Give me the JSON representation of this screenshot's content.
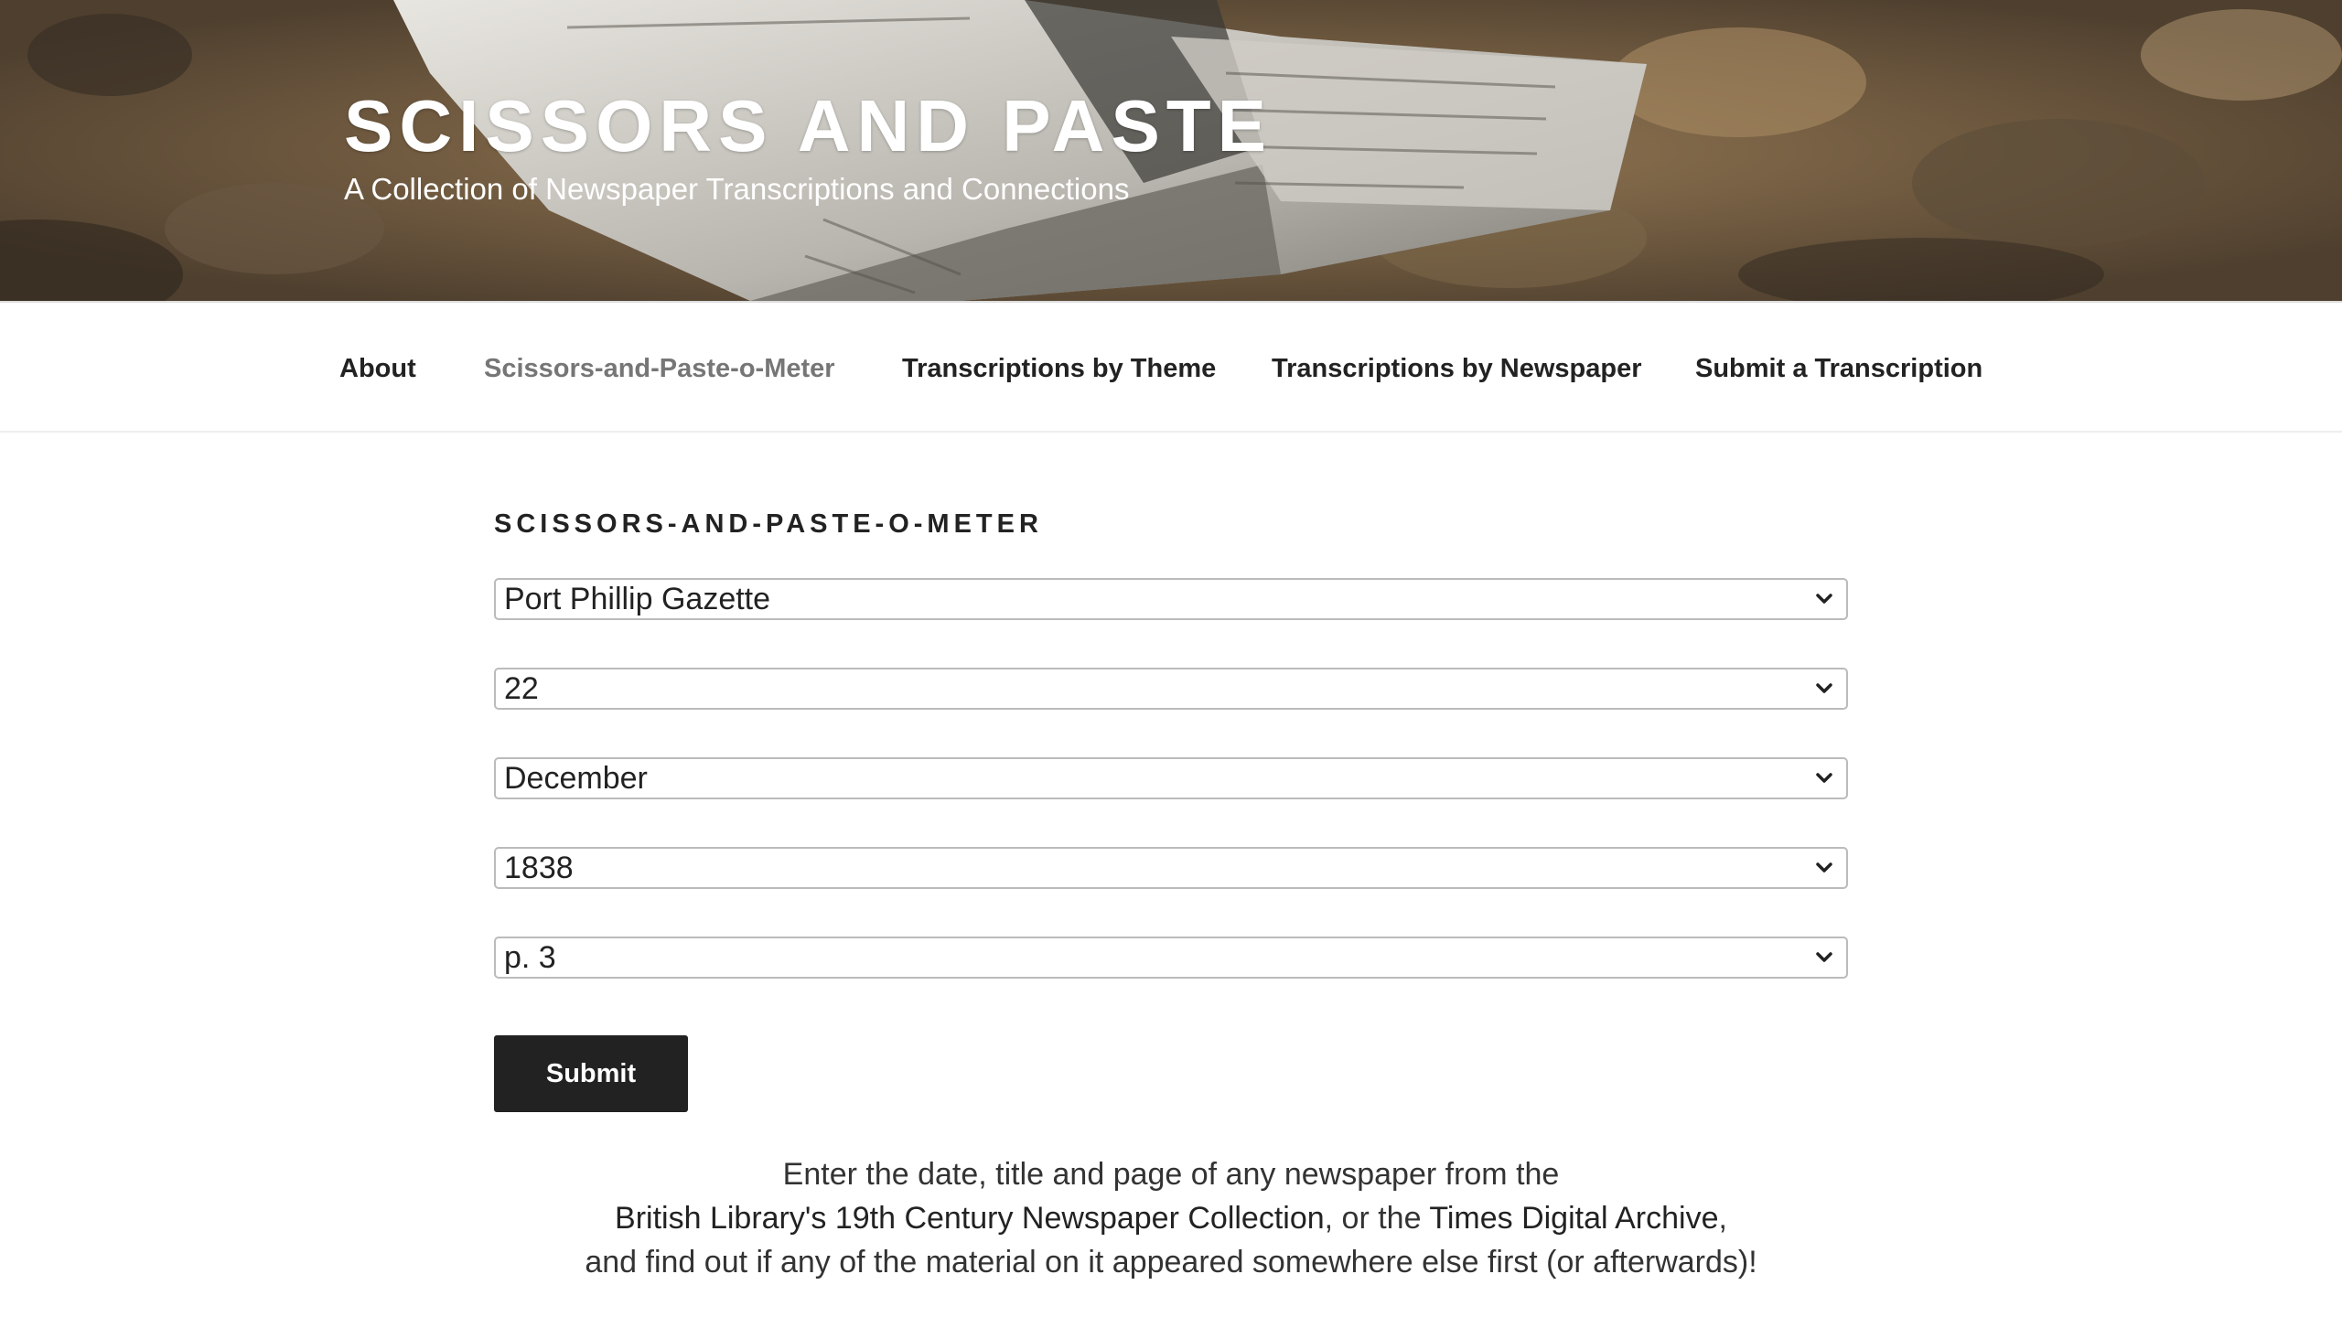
{
  "site": {
    "title": "SCISSORS AND PASTE",
    "description": "A Collection of Newspaper Transcriptions and Connections"
  },
  "nav": {
    "items": [
      {
        "label": "About",
        "current": false
      },
      {
        "label": "Scissors-and-Paste-o-Meter",
        "current": true
      },
      {
        "label": "Transcriptions by Theme",
        "current": false
      },
      {
        "label": "Transcriptions by Newspaper",
        "current": false
      },
      {
        "label": "Submit a Transcription",
        "current": false
      }
    ]
  },
  "main": {
    "heading": "SCISSORS-AND-PASTE-O-METER",
    "selects": {
      "newspaper": "Port Phillip Gazette",
      "day": "22",
      "month": "December",
      "year": "1838",
      "page": "p. 3"
    },
    "submit_label": "Submit",
    "intro": {
      "line1": "Enter the date, title and page of any newspaper from the",
      "link1": "British Library's 19th Century Newspaper Collection",
      "line2_mid": ", or the ",
      "link2": "Times Digital Archive",
      "line2_end": ",",
      "line3": "and find out if any of the material on it appeared somewhere else first (or afterwards)!"
    }
  },
  "colors": {
    "text": "#222222",
    "nav_current": "#767676",
    "button_bg": "#222222",
    "button_text": "#ffffff"
  },
  "icons": {
    "select": "chevron-down-icon"
  }
}
